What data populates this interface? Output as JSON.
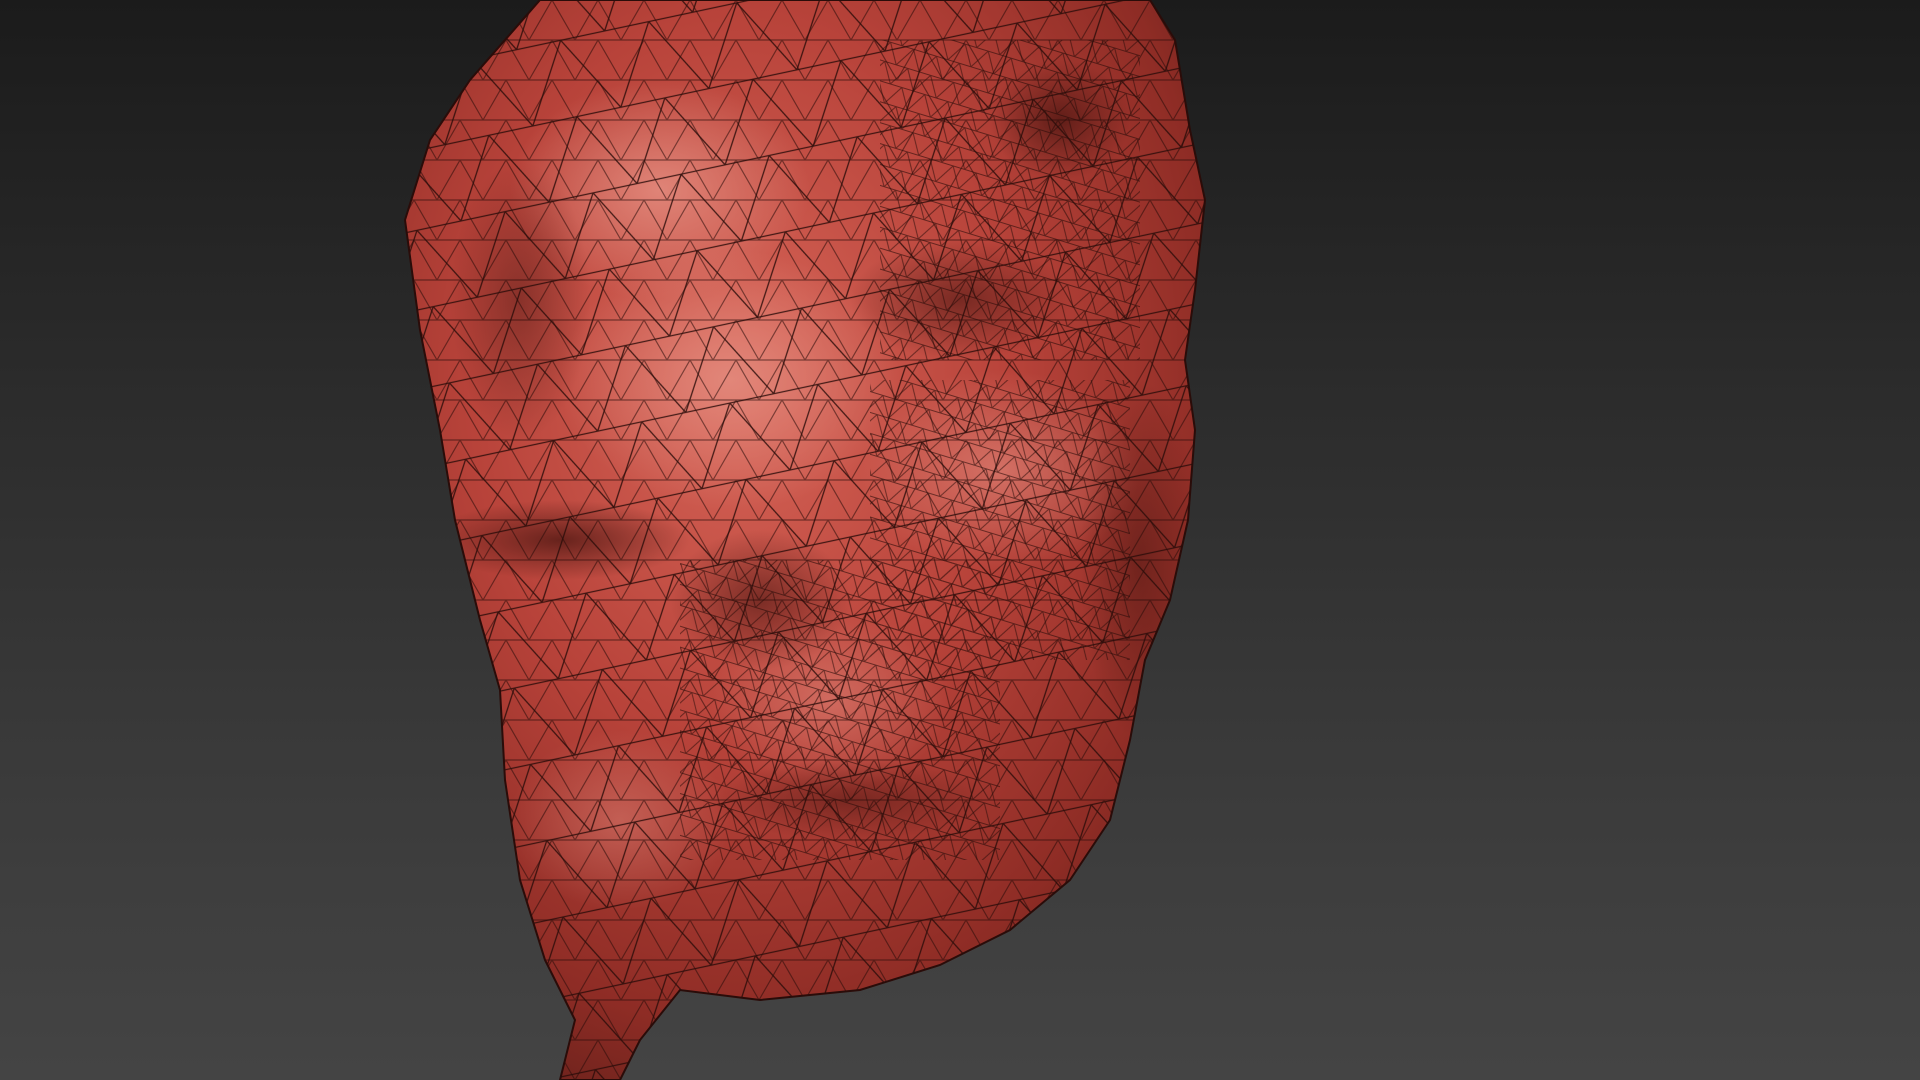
{
  "viewport": {
    "background_top": "#1b1b1b",
    "background_bottom": "#444444"
  },
  "mesh": {
    "subject": "rock-sculpt-wireframe",
    "base_color": "#b8433a",
    "highlight_color": "#e07a6c",
    "shadow_color": "#5e1e18",
    "wire_color": "#2a0c09"
  }
}
